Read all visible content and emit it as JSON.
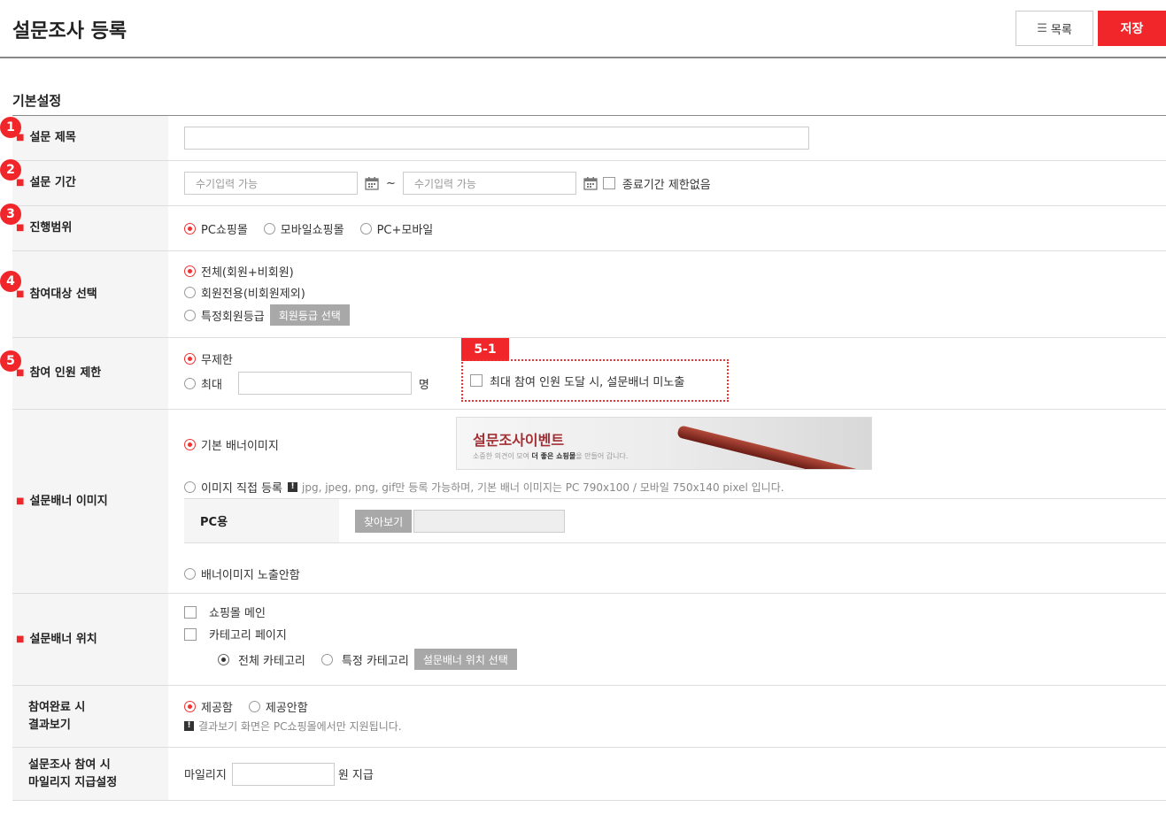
{
  "header": {
    "title": "설문조사 등록",
    "list_button": "목록",
    "save_button": "저장"
  },
  "section": {
    "title": "기본설정"
  },
  "badges": {
    "b1": "1",
    "b2": "2",
    "b3": "3",
    "b4": "4",
    "b5": "5",
    "b51": "5-1"
  },
  "colors": {
    "accent": "#f0262a",
    "label_bg": "#f5f5f5",
    "gray_button": "#a8a8a8"
  },
  "rows": {
    "title": {
      "label": "설문 제목",
      "value": ""
    },
    "period": {
      "label": "설문 기간",
      "start_placeholder": "수기입력 가능",
      "tilde": "~",
      "end_placeholder": "수기입력 가능",
      "no_end_label": "종료기간 제한없음"
    },
    "scope": {
      "label": "진행범위",
      "options": [
        "PC쇼핑몰",
        "모바일쇼핑몰",
        "PC+모바일"
      ],
      "selected": "PC쇼핑몰"
    },
    "target": {
      "label": "참여대상 선택",
      "options": [
        "전체(회원+비회원)",
        "회원전용(비회원제외)",
        "특정회원등급"
      ],
      "grade_button": "회원등급 선택",
      "selected": "전체(회원+비회원)"
    },
    "limit": {
      "label": "참여 인원 제한",
      "unlimited": "무제한",
      "max": "최대",
      "unit": "명",
      "hide_banner_label": "최대 참여 인원 도달 시, 설문배너 미노출"
    },
    "banner_image": {
      "label": "설문배너 이미지",
      "default_option": "기본 배너이미지",
      "banner_title": "설문조사이벤트",
      "banner_sub_1": "소중한 의견이 모여 ",
      "banner_sub_bold": "더 좋은 쇼핑몰",
      "banner_sub_2": "을 만들어 갑니다.",
      "custom_option": "이미지 직접 등록",
      "custom_note": "jpg, jpeg, png, gif만 등록 가능하며, 기본 배너 이미지는 PC 790x100 / 모바일 750x140 pixel 입니다.",
      "pc_label": "PC용",
      "browse_button": "찾아보기",
      "hide_option": "배너이미지 노출안함"
    },
    "banner_position": {
      "label": "설문배너 위치",
      "main_option": "쇼핑몰 메인",
      "category_option": "카테고리 페이지",
      "all_category": "전체 카테고리",
      "specific_category": "특정 카테고리",
      "position_button": "설문배너 위치 선택"
    },
    "result_view": {
      "label_1": "참여완료 시",
      "label_2": "결과보기",
      "provide": "제공함",
      "no_provide": "제공안함",
      "note": "결과보기 화면은 PC쇼핑몰에서만 지원됩니다."
    },
    "mileage": {
      "label_1": "설문조사 참여 시",
      "label_2": "마일리지 지급설정",
      "prefix": "마일리지",
      "suffix": "원 지급"
    }
  }
}
